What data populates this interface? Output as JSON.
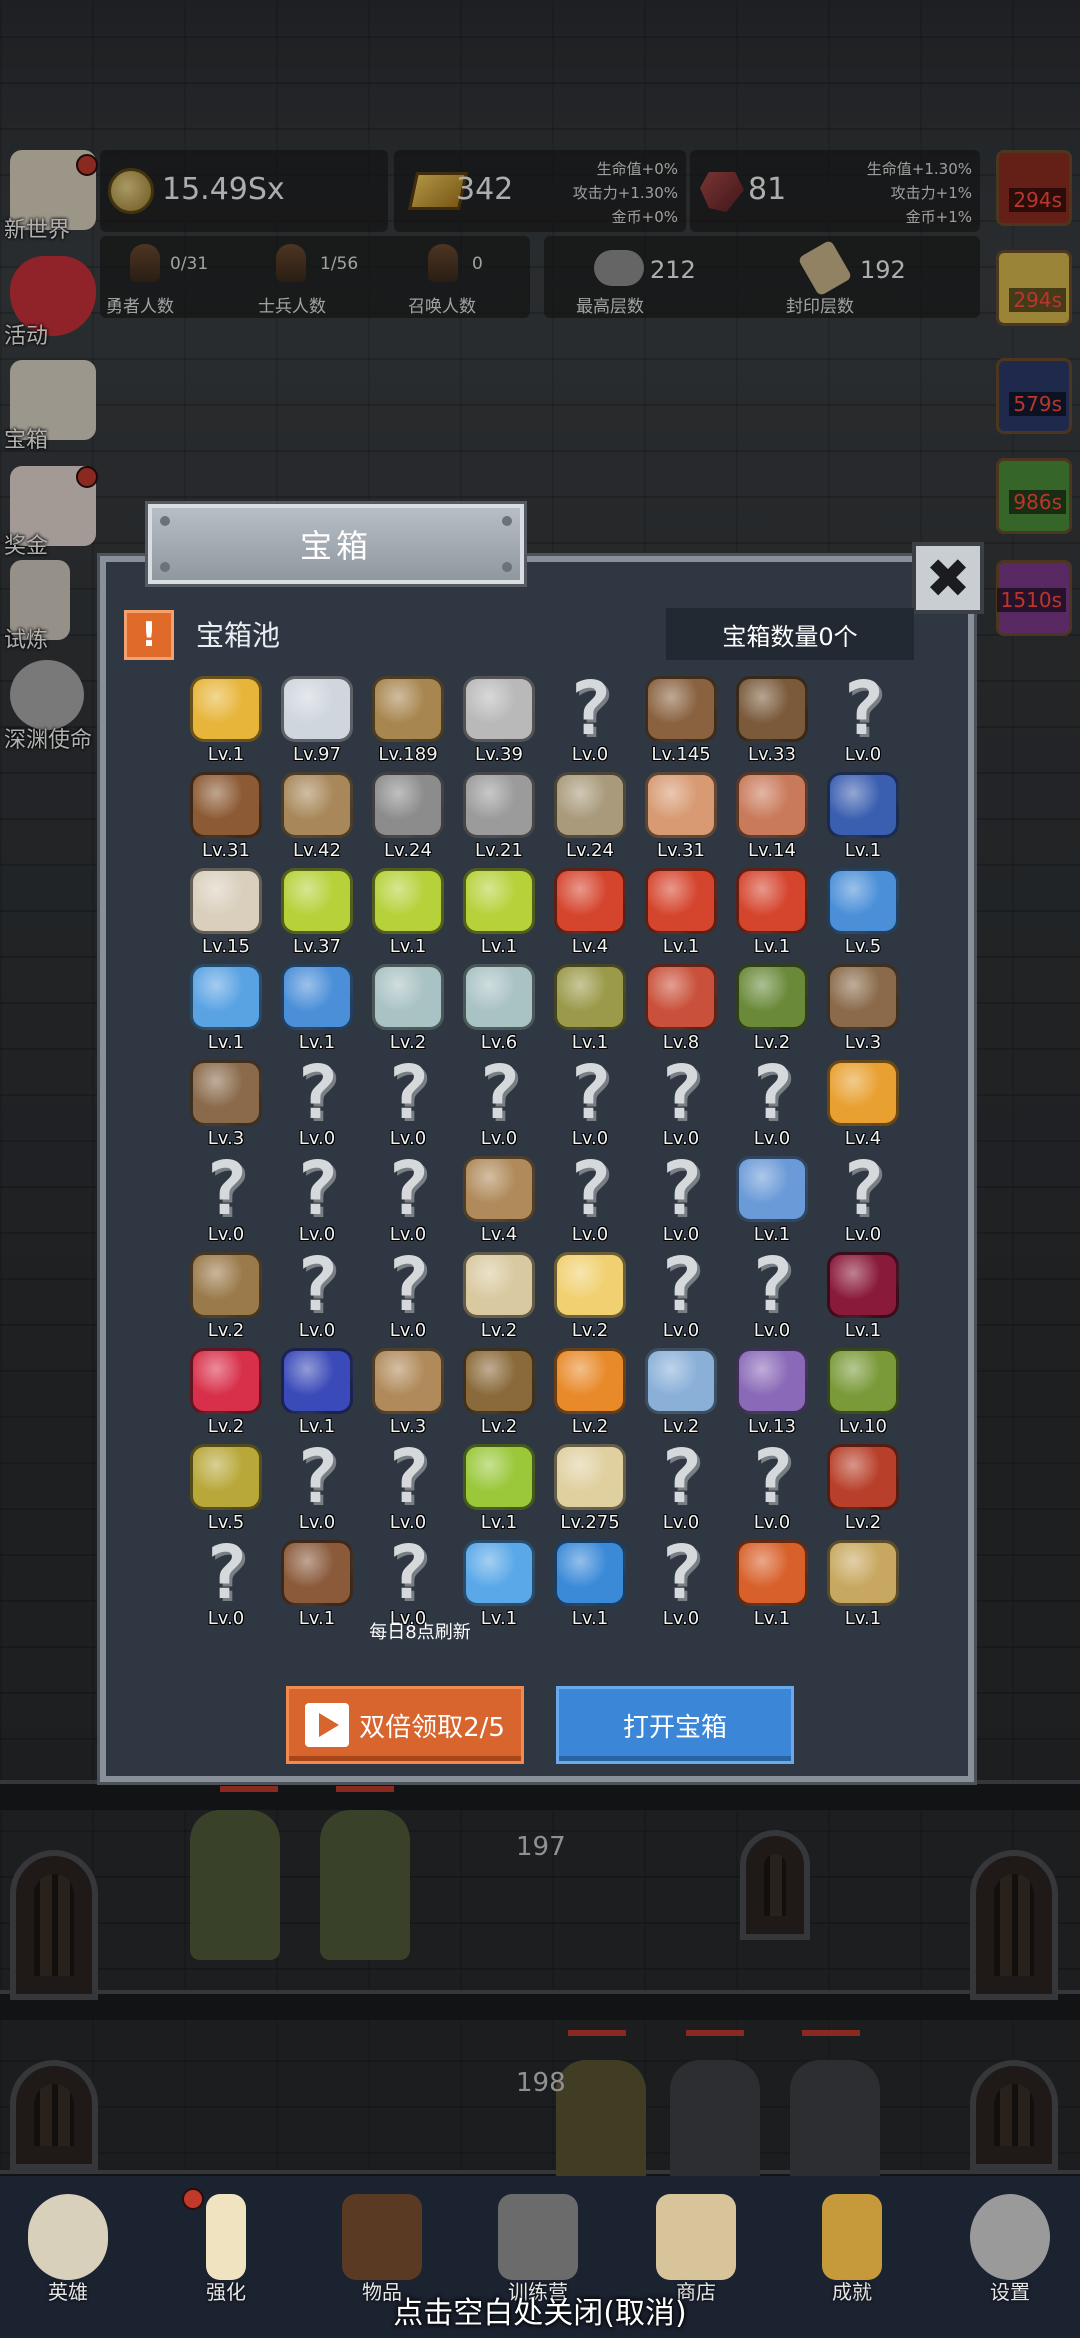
{
  "resources": {
    "coins": "15.49Sx",
    "gold": "342",
    "gold_bonus": [
      "生命值+0%",
      "攻击力+1.30%",
      "金币+0%"
    ],
    "ruby": "81",
    "ruby_bonus": [
      "生命值+1.30%",
      "攻击力+1%",
      "金币+1%"
    ]
  },
  "counts": {
    "heroes": {
      "value": "0/31",
      "label": "勇者人数"
    },
    "soldiers": {
      "value": "1/56",
      "label": "士兵人数"
    },
    "summons": {
      "value": "0",
      "label": "召唤人数"
    },
    "highest_floor": {
      "value": "212",
      "label": "最高层数"
    },
    "sealed_floor": {
      "value": "192",
      "label": "封印层数"
    }
  },
  "side_menu": [
    "新世界",
    "活动",
    "宝箱",
    "奖金",
    "试炼",
    "深渊使命"
  ],
  "timers": [
    "294s",
    "294s",
    "579s",
    "986s",
    "1510s"
  ],
  "modal": {
    "title": "宝箱",
    "pool_label": "宝箱池",
    "pool_icon": "!",
    "chest_count": "宝箱数量0个",
    "close_glyph": "✖",
    "refresh_note": "每日8点刷新",
    "double_button": "双倍领取2/5",
    "open_button": "打开宝箱"
  },
  "items": [
    {
      "icon": "crown",
      "lv": "Lv.1"
    },
    {
      "icon": "diamond",
      "lv": "Lv.97"
    },
    {
      "icon": "wood-sword",
      "lv": "Lv.189"
    },
    {
      "icon": "steel-sword",
      "lv": "Lv.39"
    },
    {
      "icon": "unknown",
      "lv": "Lv.0"
    },
    {
      "icon": "leather-armor",
      "lv": "Lv.145"
    },
    {
      "icon": "backpack-armor",
      "lv": "Lv.33"
    },
    {
      "icon": "unknown",
      "lv": "Lv.0"
    },
    {
      "icon": "leather-helmet",
      "lv": "Lv.31"
    },
    {
      "icon": "dagger",
      "lv": "Lv.42"
    },
    {
      "icon": "knight-helmet",
      "lv": "Lv.24"
    },
    {
      "icon": "hammer",
      "lv": "Lv.21"
    },
    {
      "icon": "great-helm",
      "lv": "Lv.24"
    },
    {
      "icon": "meat-leg",
      "lv": "Lv.31"
    },
    {
      "icon": "steak",
      "lv": "Lv.14"
    },
    {
      "icon": "honey-jar",
      "lv": "Lv.1"
    },
    {
      "icon": "bread",
      "lv": "Lv.15"
    },
    {
      "icon": "yellow-potion",
      "lv": "Lv.37"
    },
    {
      "icon": "yellow-potion",
      "lv": "Lv.1"
    },
    {
      "icon": "yellow-potion",
      "lv": "Lv.1"
    },
    {
      "icon": "red-potion",
      "lv": "Lv.4"
    },
    {
      "icon": "red-potion",
      "lv": "Lv.1"
    },
    {
      "icon": "red-potion",
      "lv": "Lv.1"
    },
    {
      "icon": "blue-potion",
      "lv": "Lv.5"
    },
    {
      "icon": "blue-flask",
      "lv": "Lv.1"
    },
    {
      "icon": "blue-potion",
      "lv": "Lv.1"
    },
    {
      "icon": "grey-bottle",
      "lv": "Lv.2"
    },
    {
      "icon": "grey-bottle",
      "lv": "Lv.6"
    },
    {
      "icon": "olive-bottle",
      "lv": "Lv.1"
    },
    {
      "icon": "red-bottle",
      "lv": "Lv.8"
    },
    {
      "icon": "winged-boot",
      "lv": "Lv.2"
    },
    {
      "icon": "boot",
      "lv": "Lv.3"
    },
    {
      "icon": "boot",
      "lv": "Lv.3"
    },
    {
      "icon": "unknown",
      "lv": "Lv.0"
    },
    {
      "icon": "unknown",
      "lv": "Lv.0"
    },
    {
      "icon": "unknown",
      "lv": "Lv.0"
    },
    {
      "icon": "unknown",
      "lv": "Lv.0"
    },
    {
      "icon": "unknown",
      "lv": "Lv.0"
    },
    {
      "icon": "unknown",
      "lv": "Lv.0"
    },
    {
      "icon": "torch",
      "lv": "Lv.4"
    },
    {
      "icon": "unknown",
      "lv": "Lv.0"
    },
    {
      "icon": "unknown",
      "lv": "Lv.0"
    },
    {
      "icon": "unknown",
      "lv": "Lv.0"
    },
    {
      "icon": "wood-staff",
      "lv": "Lv.4"
    },
    {
      "icon": "unknown",
      "lv": "Lv.0"
    },
    {
      "icon": "unknown",
      "lv": "Lv.0"
    },
    {
      "icon": "blue-wand",
      "lv": "Lv.1"
    },
    {
      "icon": "unknown",
      "lv": "Lv.0"
    },
    {
      "icon": "backpack",
      "lv": "Lv.2"
    },
    {
      "icon": "unknown",
      "lv": "Lv.0"
    },
    {
      "icon": "unknown",
      "lv": "Lv.0"
    },
    {
      "icon": "bone-club",
      "lv": "Lv.2"
    },
    {
      "icon": "cheese",
      "lv": "Lv.2"
    },
    {
      "icon": "unknown",
      "lv": "Lv.0"
    },
    {
      "icon": "unknown",
      "lv": "Lv.0"
    },
    {
      "icon": "dark-crystal",
      "lv": "Lv.1"
    },
    {
      "icon": "red-orb",
      "lv": "Lv.2"
    },
    {
      "icon": "cube-gem",
      "lv": "Lv.1"
    },
    {
      "icon": "bow",
      "lv": "Lv.3"
    },
    {
      "icon": "quiver",
      "lv": "Lv.2"
    },
    {
      "icon": "fire-shield",
      "lv": "Lv.2"
    },
    {
      "icon": "ice-shield",
      "lv": "Lv.2"
    },
    {
      "icon": "tentacle-shield",
      "lv": "Lv.13"
    },
    {
      "icon": "green-shield",
      "lv": "Lv.10"
    },
    {
      "icon": "magic-scroll",
      "lv": "Lv.5"
    },
    {
      "icon": "unknown",
      "lv": "Lv.0"
    },
    {
      "icon": "unknown",
      "lv": "Lv.0"
    },
    {
      "icon": "green-wand",
      "lv": "Lv.1"
    },
    {
      "icon": "beer-mug",
      "lv": "Lv.275"
    },
    {
      "icon": "unknown",
      "lv": "Lv.0"
    },
    {
      "icon": "unknown",
      "lv": "Lv.0"
    },
    {
      "icon": "spell-book",
      "lv": "Lv.2"
    },
    {
      "icon": "unknown",
      "lv": "Lv.0"
    },
    {
      "icon": "vine-bow",
      "lv": "Lv.1"
    },
    {
      "icon": "unknown",
      "lv": "Lv.0"
    },
    {
      "icon": "crystal-ball",
      "lv": "Lv.1"
    },
    {
      "icon": "rune-disc",
      "lv": "Lv.1"
    },
    {
      "icon": "unknown",
      "lv": "Lv.0"
    },
    {
      "icon": "fire-arrow",
      "lv": "Lv.1"
    },
    {
      "icon": "skull-badge",
      "lv": "Lv.1"
    }
  ],
  "floors": [
    "197",
    "198"
  ],
  "bottom_nav": [
    "英雄",
    "强化",
    "物品",
    "训练营",
    "商店",
    "成就",
    "设置"
  ],
  "close_hint": "点击空白处关闭(取消)"
}
